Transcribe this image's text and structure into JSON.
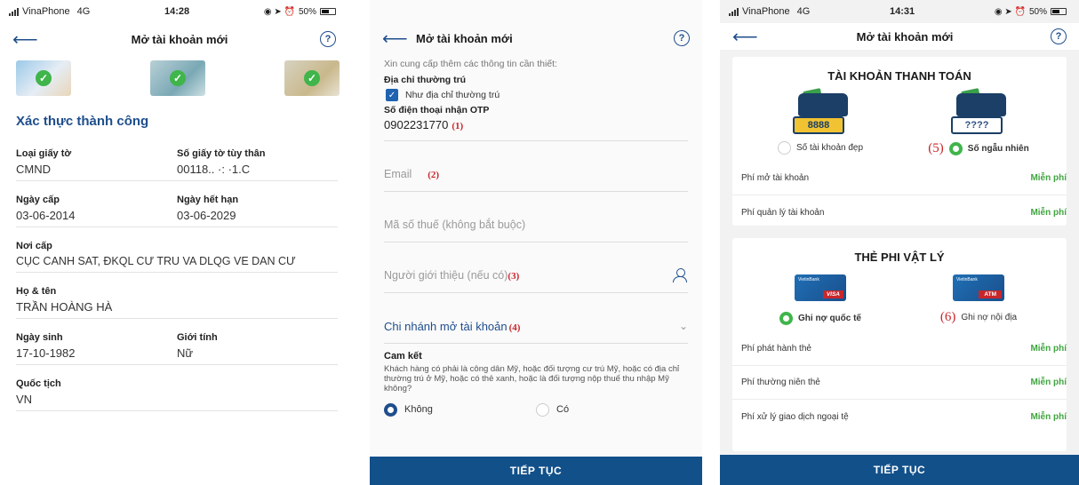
{
  "screen1": {
    "status": {
      "carrier": "VinaPhone",
      "network": "4G",
      "time": "14:28",
      "battery": "50%"
    },
    "title": "Mở tài khoản mới",
    "help": "?",
    "success": "Xác thực thành công",
    "fields": [
      [
        {
          "label": "Loại giấy tờ",
          "value": "CMND"
        },
        {
          "label": "Số giấy tờ tùy thân",
          "value": "00118.. ·: ·1.C"
        }
      ],
      [
        {
          "label": "Ngày cấp",
          "value": "03-06-2014"
        },
        {
          "label": "Ngày hết hạn",
          "value": "03-06-2029"
        }
      ],
      [
        {
          "label": "Nơi cấp",
          "value": "CỤC CANH SAT, ĐKQL CƯ TRU VA DLQG VE DAN CƯ"
        }
      ],
      [
        {
          "label": "Họ & tên",
          "value": "TRẦN HOÀNG HÀ"
        }
      ],
      [
        {
          "label": "Ngày sinh",
          "value": "17-10-1982"
        },
        {
          "label": "Giới tính",
          "value": "Nữ"
        }
      ],
      [
        {
          "label": "Quốc tịch",
          "value": "VN"
        }
      ]
    ]
  },
  "screen2": {
    "title": "Mở tài khoản mới",
    "help": "?",
    "intro": "Xin cung cấp thêm các thông tin cần thiết:",
    "address_label": "Địa chỉ thường trú",
    "same_address": "Như địa chỉ thường trú",
    "phone_label": "Số điện thoại nhận OTP",
    "phone": "0902231770",
    "mark1": "(1)",
    "email_placeholder": "Email",
    "mark2": "(2)",
    "tax_placeholder": "Mã số thuế (không bắt buộc)",
    "referrer_placeholder": "Người giới thiệu (nếu có)",
    "mark3": "(3)",
    "branch": "Chi nhánh mở tài khoản",
    "mark4": "(4)",
    "commit_title": "Cam kết",
    "commit_question": "Khách hàng có phải là công dân Mỹ, hoặc đối tượng cư trú Mỹ, hoặc có địa chỉ thường trú ở Mỹ, hoặc có thẻ xanh, hoặc là đối tượng nộp thuế thu nhập Mỹ không?",
    "opt_no": "Không",
    "opt_yes": "Có",
    "continue": "TIẾP TỤC"
  },
  "screen3": {
    "status": {
      "carrier": "VinaPhone",
      "network": "4G",
      "time": "14:31",
      "battery": "50%"
    },
    "title": "Mở tài khoản mới",
    "help": "?",
    "account": {
      "title": "TÀI KHOẢN THANH TOÁN",
      "opt1_number": "8888",
      "opt1_label": "Số tài khoản đẹp",
      "opt2_number": "????",
      "opt2_label": "Số ngẫu nhiên",
      "mark5": "(5)",
      "fees": [
        {
          "name": "Phí mở tài khoản",
          "value": "Miễn phí"
        },
        {
          "name": "Phí quản lý tài khoản",
          "value": "Miễn phí"
        }
      ]
    },
    "card": {
      "title": "THẺ PHI VẬT LÝ",
      "brand": "VietinBank",
      "visa_tag": "VISA",
      "atm_tag": "ATM",
      "opt1_label": "Ghi nợ quốc tế",
      "opt2_label": "Ghi nợ nội địa",
      "mark6": "(6)",
      "fees": [
        {
          "name": "Phí phát hành thẻ",
          "value": "Miễn phí"
        },
        {
          "name": "Phí thường niên thẻ",
          "value": "Miễn phí"
        },
        {
          "name": "Phí xử lý giao dịch ngoại tệ",
          "value": "Miễn phí"
        }
      ]
    },
    "continue": "TIẾP TỤC"
  }
}
